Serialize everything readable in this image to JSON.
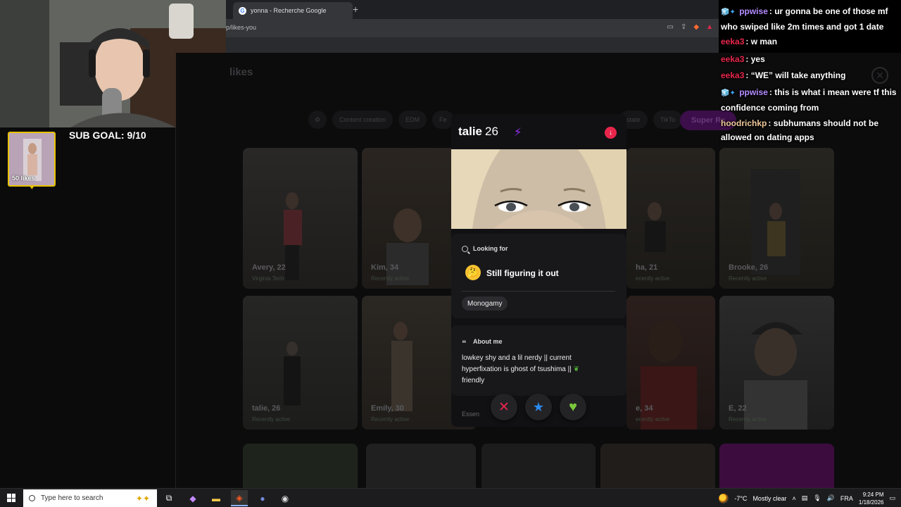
{
  "browser": {
    "tab_title": "yonna - Recherche Google",
    "new_tab": "+",
    "url": "p/likes-you"
  },
  "page": {
    "title": "likes",
    "filters": [
      "Content creation",
      "EDM",
      "Fe",
      "state",
      "TikTo"
    ],
    "super_filter": "Super Re"
  },
  "cards": [
    {
      "name": "Avery, 22",
      "sub": "Virginia Tech"
    },
    {
      "name": "Kim, 34",
      "sub": "Recently active"
    },
    {
      "name": "ha, 21",
      "sub": "ecently active"
    },
    {
      "name": "Brooke, 26",
      "sub": "Recently active"
    },
    {
      "name": "talie, 26",
      "sub": "Recently active"
    },
    {
      "name": "Emily, 30",
      "sub": "Recently active"
    },
    {
      "name": "e, 34",
      "sub": "ecently active"
    },
    {
      "name": "E, 22",
      "sub": "Recently active"
    }
  ],
  "profile": {
    "name": "talie",
    "age": "26",
    "looking_for_label": "Looking for",
    "looking_for_value": "Still figuring it out",
    "looking_for_emoji": "🤔",
    "tag": "Monogamy",
    "about_label": "About me",
    "about_text": "lowkey shy and a lil nerdy || current hyperfixation is ghost of tsushima ||",
    "about_text_end": "friendly",
    "essentials_label": "Essen"
  },
  "stream": {
    "sub_goal": "SUB GOAL: 9/10",
    "sub_likes": "50 likes"
  },
  "chat": [
    {
      "user": "ppwise",
      "color": "#b48cff",
      "badges": "🧊✦",
      "text": "ur gonna be one of those mf who swiped like 2m times and got 1 date"
    },
    {
      "user": "eeka3",
      "color": "#e8264b",
      "badges": "",
      "text": "w man"
    },
    {
      "user": "eeka3",
      "color": "#e8264b",
      "badges": "",
      "text": "yes"
    },
    {
      "user": "eeka3",
      "color": "#e8264b",
      "badges": "",
      "text": "“WE” will take anything"
    },
    {
      "user": "ppwise",
      "color": "#b48cff",
      "badges": "🧊✦",
      "text": "this is what i mean were tf this confidence coming from"
    },
    {
      "user": "hoodrichkp",
      "color": "#f0c89a",
      "badges": "",
      "text": "subhumans should not be allowed on dating apps"
    }
  ],
  "taskbar": {
    "search_placeholder": "Type here to search",
    "temperature": "-7°C",
    "weather": "Mostly clear",
    "language": "FRA",
    "time": "9:24 PM",
    "date": "1/18/2026"
  },
  "colors": {
    "accent_red": "#e8264b",
    "accent_purple": "#9b30ff",
    "like_green": "#7ac83a",
    "star_blue": "#2a8cf0",
    "sub_gold": "#e8c200"
  }
}
